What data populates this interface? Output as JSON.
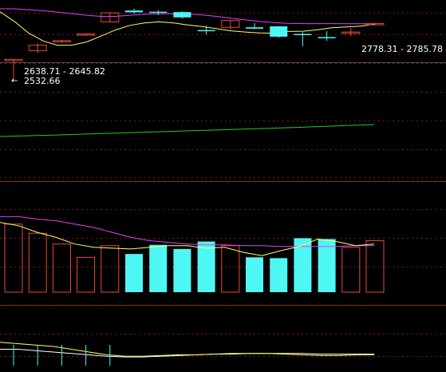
{
  "colors": {
    "up": "#e8473f",
    "down": "#4ef6f4",
    "ma_short": "#ffff66",
    "ma_long": "#e040fb",
    "trend": "#22cc22",
    "grid": "#7a1a1a",
    "divider": "#a02020"
  },
  "chart_data": [
    {
      "type": "candlestick",
      "panel": "price",
      "annotations": {
        "range_right": "2778.31 - 2785.78",
        "range_left": "2638.71 - 2645.82",
        "low_marker": "2532.66",
        "low_marker_arrow": "←"
      },
      "ylim": [
        2500,
        2950
      ],
      "candles": [
        {
          "dir": "up",
          "open": 2638.71,
          "close": 2645.82,
          "high": 2648,
          "low": 2532.66
        },
        {
          "dir": "up",
          "open": 2690,
          "close": 2718,
          "high": 2730,
          "low": 2678
        },
        {
          "dir": "up",
          "open": 2736,
          "close": 2742,
          "high": 2746,
          "low": 2732
        },
        {
          "dir": "up",
          "open": 2771,
          "close": 2776,
          "high": 2779,
          "low": 2768
        },
        {
          "dir": "up",
          "open": 2838,
          "close": 2884,
          "high": 2887,
          "low": 2835
        },
        {
          "dir": "down",
          "open": 2896,
          "close": 2887,
          "high": 2906,
          "low": 2880
        },
        {
          "dir": "down",
          "open": 2890,
          "close": 2884,
          "high": 2898,
          "low": 2873
        },
        {
          "dir": "down",
          "open": 2888,
          "close": 2861,
          "high": 2892,
          "low": 2855
        },
        {
          "dir": "down",
          "open": 2796,
          "close": 2790,
          "high": 2818,
          "low": 2774
        },
        {
          "dir": "up",
          "open": 2810,
          "close": 2845,
          "high": 2848,
          "low": 2798
        },
        {
          "dir": "down",
          "open": 2810,
          "close": 2803,
          "high": 2832,
          "low": 2800
        },
        {
          "dir": "down",
          "open": 2815,
          "close": 2762,
          "high": 2818,
          "low": 2756
        },
        {
          "dir": "down",
          "open": 2776,
          "close": 2771,
          "high": 2785,
          "low": 2713
        },
        {
          "dir": "down",
          "open": 2760,
          "close": 2754,
          "high": 2790,
          "low": 2740
        },
        {
          "dir": "up",
          "open": 2778.31,
          "close": 2785.78,
          "high": 2806,
          "low": 2765
        },
        {
          "dir": "up",
          "open": 2824,
          "close": 2829,
          "high": 2834,
          "low": 2820
        }
      ],
      "ma_short": [
        2890,
        2840,
        2780,
        2740,
        2718,
        2719,
        2735,
        2765,
        2796,
        2820,
        2832,
        2838,
        2833,
        2822,
        2814,
        2803,
        2792,
        2786,
        2781,
        2780,
        2789,
        2790,
        2797,
        2808,
        2812,
        2816,
        2826
      ],
      "ma_long": [
        2905,
        2905,
        2900,
        2895,
        2888,
        2880,
        2872,
        2866,
        2866,
        2872,
        2877,
        2879,
        2880,
        2878,
        2874,
        2866,
        2857,
        2848,
        2840,
        2834,
        2830,
        2829,
        2829,
        2829,
        2828,
        2828,
        2828
      ]
    },
    {
      "type": "line",
      "panel": "trend",
      "values": [
        0,
        4,
        8,
        13,
        18,
        23,
        28,
        33,
        38,
        43,
        48,
        53,
        58,
        63,
        68,
        73,
        78,
        84,
        90,
        96,
        102
      ]
    },
    {
      "type": "bar",
      "panel": "volume",
      "bars": [
        {
          "dir": "up",
          "value": 82
        },
        {
          "dir": "up",
          "value": 71
        },
        {
          "dir": "up",
          "value": 58
        },
        {
          "dir": "up",
          "value": 42
        },
        {
          "dir": "up",
          "value": 56
        },
        {
          "dir": "down",
          "value": 46
        },
        {
          "dir": "down",
          "value": 57
        },
        {
          "dir": "down",
          "value": 52
        },
        {
          "dir": "down",
          "value": 61
        },
        {
          "dir": "up",
          "value": 56
        },
        {
          "dir": "down",
          "value": 42
        },
        {
          "dir": "down",
          "value": 41
        },
        {
          "dir": "down",
          "value": 65
        },
        {
          "dir": "down",
          "value": 64
        },
        {
          "dir": "up",
          "value": 54
        },
        {
          "dir": "up",
          "value": 62
        }
      ],
      "ylim": [
        0,
        100
      ],
      "ma_short": [
        84,
        80,
        72,
        66,
        58,
        54,
        53,
        52,
        54,
        56,
        56,
        53,
        54,
        48,
        44,
        50,
        55,
        64,
        61,
        56,
        58
      ],
      "ma_long": [
        91,
        91,
        88,
        86,
        82,
        78,
        72,
        66,
        62,
        60,
        58,
        57,
        57,
        56,
        56,
        55,
        55,
        55,
        55,
        56,
        56
      ]
    },
    {
      "type": "line",
      "panel": "indicator",
      "ma_short": [
        30,
        28,
        26,
        24,
        20,
        16,
        12,
        10,
        10,
        11,
        12,
        12,
        13,
        14,
        14,
        14,
        13,
        12,
        11,
        11,
        12,
        12
      ],
      "ma_long": [
        20,
        20,
        18,
        16,
        14,
        12,
        10,
        9,
        9,
        10,
        11,
        12,
        13,
        13,
        14,
        14,
        14,
        14,
        13,
        13,
        13,
        13
      ],
      "ylim": [
        0,
        40
      ]
    }
  ]
}
